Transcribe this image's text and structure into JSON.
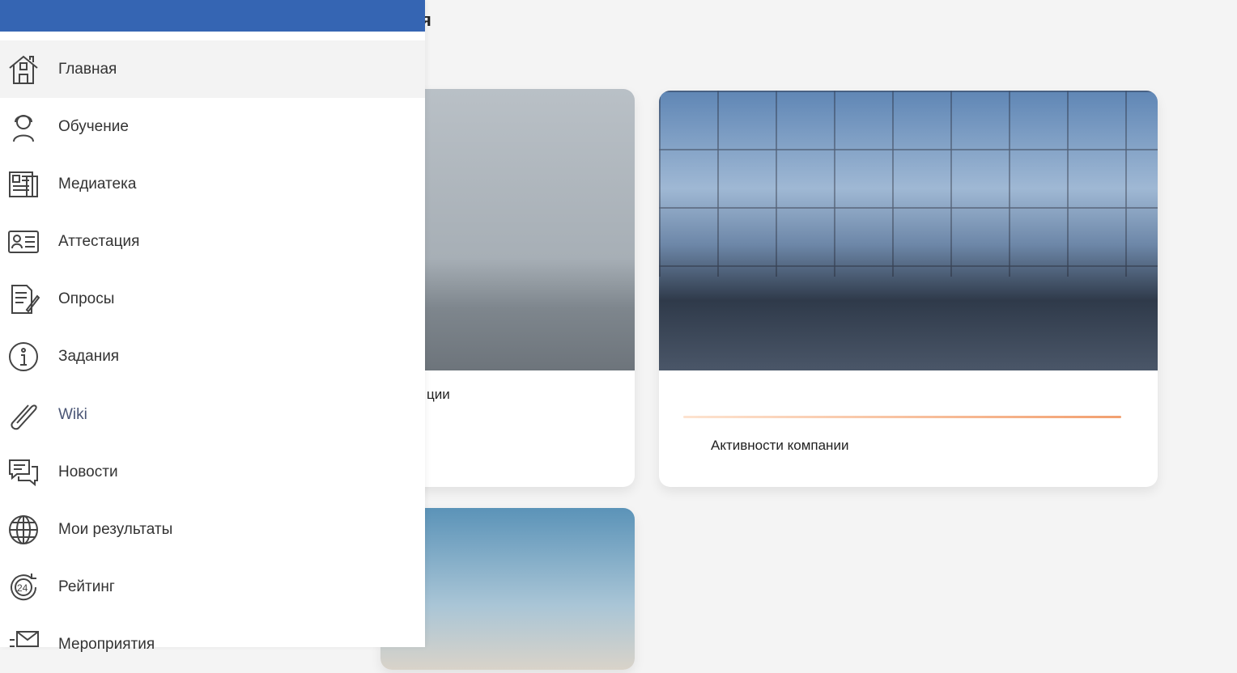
{
  "main": {
    "title_partial": "я",
    "cards": [
      {
        "title_partial": "ции"
      },
      {
        "title": "Активности компании"
      },
      {
        "title": ""
      }
    ]
  },
  "sidebar": {
    "items": [
      {
        "label": "Главная",
        "icon": "home-icon",
        "active": true
      },
      {
        "label": "Обучение",
        "icon": "learner-icon"
      },
      {
        "label": "Медиатека",
        "icon": "media-icon"
      },
      {
        "label": "Аттестация",
        "icon": "id-card-icon"
      },
      {
        "label": "Опросы",
        "icon": "survey-icon"
      },
      {
        "label": "Задания",
        "icon": "info-icon"
      },
      {
        "label": "Wiki",
        "icon": "paperclip-icon"
      },
      {
        "label": "Новости",
        "icon": "chat-icon"
      },
      {
        "label": "Мои результаты",
        "icon": "globe-icon"
      },
      {
        "label": "Рейтинг",
        "icon": "24h-icon"
      },
      {
        "label": "Мероприятия",
        "icon": "envelope-icon"
      }
    ]
  },
  "colors": {
    "header": "#3565b3",
    "accent_line": "#f2a070"
  }
}
